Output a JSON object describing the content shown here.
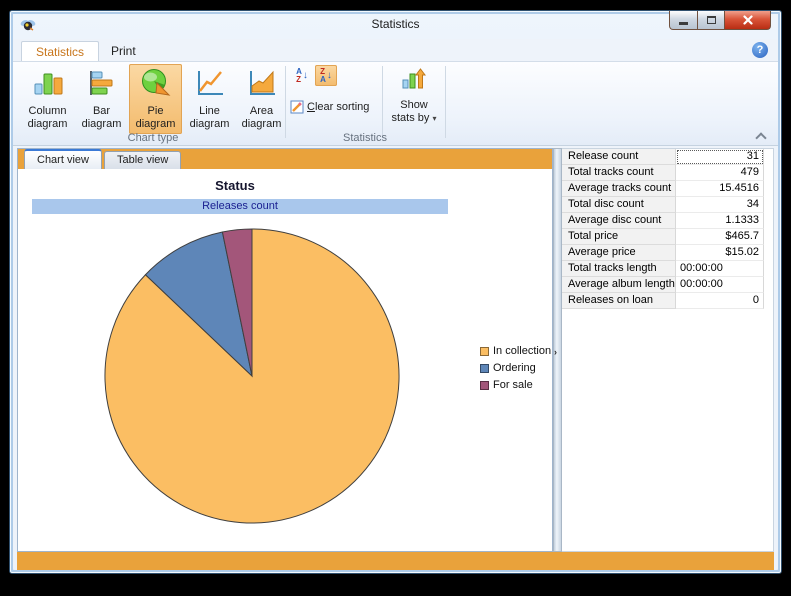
{
  "window": {
    "title": "Statistics"
  },
  "ribbon": {
    "tabs": [
      {
        "label": "Statistics"
      },
      {
        "label": "Print"
      }
    ],
    "chart_type_group": {
      "label": "Chart type",
      "buttons": [
        {
          "label1": "Column",
          "label2": "diagram"
        },
        {
          "label1": "Bar",
          "label2": "diagram"
        },
        {
          "label1": "Pie",
          "label2": "diagram"
        },
        {
          "label1": "Line",
          "label2": "diagram"
        },
        {
          "label1": "Area",
          "label2": "diagram"
        }
      ]
    },
    "statistics_group": {
      "label": "Statistics",
      "sort_ascending_letters": [
        "A",
        "Z"
      ],
      "sort_descending_letters": [
        "Z",
        "A"
      ],
      "sort_arrow": "↓",
      "clear_mnemonic": "C",
      "clear_rest": "lear sorting",
      "show_stats_line1": "Show",
      "show_stats_line2": "stats by",
      "dropdown_glyph": "▾"
    },
    "help_glyph": "?"
  },
  "view_tabs": [
    {
      "label": "Chart view"
    },
    {
      "label": "Table view"
    }
  ],
  "chart_data": {
    "type": "pie",
    "title": "Status",
    "series_banner": "Releases count",
    "total": 31,
    "legend_position": "right",
    "slices": [
      {
        "label": "In collection",
        "value": 27,
        "color": "#FBBE63"
      },
      {
        "label": "Ordering",
        "value": 3,
        "color": "#5E86B8"
      },
      {
        "label": "For sale",
        "value": 1,
        "color": "#A3567A"
      }
    ]
  },
  "stats_table": {
    "rows": [
      {
        "label": "Release count",
        "value": "31",
        "align": "right",
        "selected": true
      },
      {
        "label": "Total tracks count",
        "value": "479",
        "align": "right"
      },
      {
        "label": "Average tracks count",
        "value": "15.4516",
        "align": "right"
      },
      {
        "label": "Total disc count",
        "value": "34",
        "align": "right"
      },
      {
        "label": "Average disc count",
        "value": "1.1333",
        "align": "right"
      },
      {
        "label": "Total price",
        "value": "$465.7",
        "align": "right"
      },
      {
        "label": "Average price",
        "value": "$15.02",
        "align": "right"
      },
      {
        "label": "Total tracks length",
        "value": "00:00:00",
        "align": "left"
      },
      {
        "label": "Average album length",
        "value": "00:00:00",
        "align": "left"
      },
      {
        "label": "Releases on loan",
        "value": "0",
        "align": "right"
      }
    ]
  },
  "colors": {
    "accent_orange": "#E9A23B",
    "banner_blue": "#A9C7EC",
    "banner_text": "#1C2292",
    "active_tab_text": "#C8761C",
    "pie_outline": "#3F3F3F"
  },
  "splitter_glyph": "›"
}
